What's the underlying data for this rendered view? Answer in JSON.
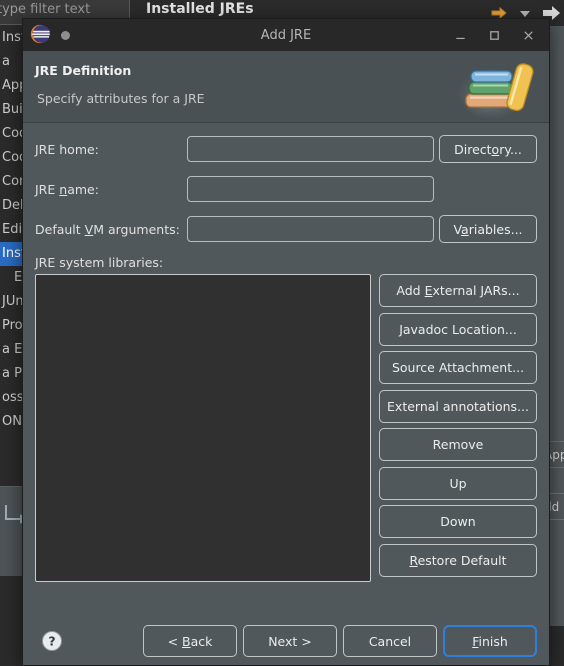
{
  "background": {
    "filter_placeholder": "type filter text",
    "page_title": "Installed JREs",
    "toolbar_icons": [
      "back-icon",
      "dropdown-icon",
      "forward-icon"
    ],
    "tree_items": [
      {
        "label": "Installa...",
        "selected": false,
        "child": false
      },
      {
        "label": "a",
        "selected": false,
        "child": false
      },
      {
        "label": "App",
        "selected": false,
        "child": false
      },
      {
        "label": "Buil",
        "selected": false,
        "child": false
      },
      {
        "label": "Cod",
        "selected": false,
        "child": false
      },
      {
        "label": "Cod",
        "selected": false,
        "child": false
      },
      {
        "label": "Com",
        "selected": false,
        "child": false
      },
      {
        "label": "Deb",
        "selected": false,
        "child": false
      },
      {
        "label": "Edit",
        "selected": false,
        "child": false
      },
      {
        "label": "Insta",
        "selected": true,
        "child": false
      },
      {
        "label": "E",
        "selected": false,
        "child": true
      },
      {
        "label": "JUni",
        "selected": false,
        "child": false
      },
      {
        "label": "Prop",
        "selected": false,
        "child": false
      },
      {
        "label": "a EE",
        "selected": false,
        "child": false
      },
      {
        "label": "a Per",
        "selected": false,
        "child": false
      },
      {
        "label": "oss T",
        "selected": false,
        "child": false
      },
      {
        "label": "ON",
        "selected": false,
        "child": false
      }
    ],
    "right_rows": [
      {
        "label": "",
        "blue": false
      },
      {
        "label": "App",
        "blue": false
      },
      {
        "label": "",
        "blue": true
      },
      {
        "label": "dd",
        "blue": true
      }
    ]
  },
  "dialog": {
    "titlebar": {
      "title": "Add JRE",
      "app_icon": "eclipse-logo-icon",
      "status_dot": "unsaved-indicator-icon",
      "minimize": "minimize-icon",
      "maximize": "maximize-icon",
      "close": "close-icon"
    },
    "banner": {
      "title": "JRE Definition",
      "subtitle": "Specify attributes for a JRE",
      "image": "books-stack-icon"
    },
    "form": {
      "jre_home": {
        "label_before": "JRE home:",
        "value": "",
        "button": {
          "before": "Direct",
          "mnemonic": "o",
          "after": "ry..."
        }
      },
      "jre_name": {
        "label_before": "JRE ",
        "label_mnemonic": "n",
        "label_after": "ame:",
        "value": ""
      },
      "vm_args": {
        "label_before": "Default ",
        "label_mnemonic": "V",
        "label_after": "M arguments:",
        "value": "",
        "button": {
          "before": "V",
          "mnemonic": "a",
          "after": "riables..."
        }
      },
      "libraries_label": "JRE system libraries:",
      "libraries_items": []
    },
    "lib_buttons": [
      {
        "before": "Add ",
        "mnemonic": "E",
        "after": "xternal JARs..."
      },
      {
        "before": "Javadoc Location...",
        "mnemonic": "",
        "after": ""
      },
      {
        "before": "Source Attachment...",
        "mnemonic": "",
        "after": ""
      },
      {
        "before": "External annotations...",
        "mnemonic": "",
        "after": ""
      },
      {
        "before": "Remove",
        "mnemonic": "",
        "after": ""
      },
      {
        "before": "Up",
        "mnemonic": "",
        "after": ""
      },
      {
        "before": "Down",
        "mnemonic": "",
        "after": ""
      },
      {
        "before": "",
        "mnemonic": "R",
        "after": "estore Default"
      }
    ],
    "footer": {
      "help": "help-icon",
      "buttons": [
        {
          "name": "back",
          "before": "< ",
          "mnemonic": "B",
          "after": "ack",
          "primary": false
        },
        {
          "name": "next",
          "before": "Next >",
          "mnemonic": "",
          "after": "",
          "primary": false
        },
        {
          "name": "cancel",
          "before": "Cancel",
          "mnemonic": "",
          "after": "",
          "primary": false
        },
        {
          "name": "finish",
          "before": "",
          "mnemonic": "F",
          "after": "inish",
          "primary": true
        }
      ]
    }
  },
  "colors": {
    "dialog_bg": "#51585b",
    "titlebar_bg": "#282828",
    "banner_bg": "#4a5154",
    "list_bg": "#303030",
    "selection_blue": "#2a6cc4",
    "focus_blue": "#2f7fd8",
    "border_light": "#c2c5c6",
    "text": "#e8e8e8"
  }
}
